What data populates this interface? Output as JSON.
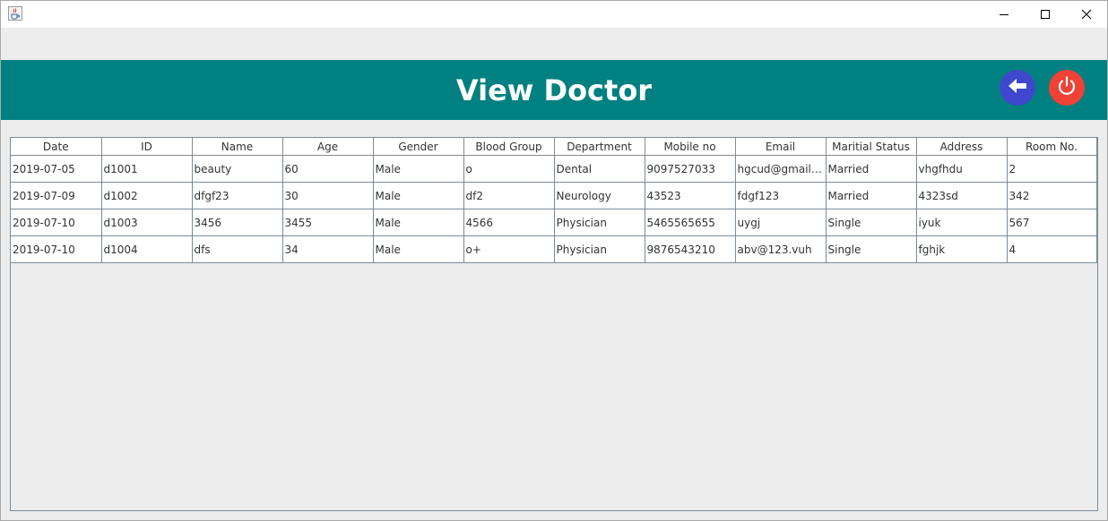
{
  "window": {
    "icon": "java-coffee-cup-icon",
    "controls": [
      "minimize-icon",
      "maximize-icon",
      "close-icon"
    ]
  },
  "header": {
    "title": "View Doctor",
    "background_color": "#008080",
    "back_button": {
      "icon": "arrow-left-icon",
      "color": "#3f48cc"
    },
    "power_button": {
      "icon": "power-icon",
      "color": "#ef4136"
    }
  },
  "table": {
    "columns": [
      "Date",
      "ID",
      "Name",
      "Age",
      "Gender",
      "Blood Group",
      "Department",
      "Mobile no",
      "Email",
      "Maritial Status",
      "Address",
      "Room No."
    ],
    "rows": [
      [
        "2019-07-05",
        "d1001",
        "beauty",
        "60",
        "Male",
        "o",
        "Dental",
        "9097527033",
        "hgcud@gmail.c...",
        "Married",
        "vhgfhdu",
        "2"
      ],
      [
        "2019-07-09",
        "d1002",
        "dfgf23",
        "30",
        "Male",
        "df2",
        "Neurology",
        "43523",
        "fdgf123",
        "Married",
        "4323sd",
        "342"
      ],
      [
        "2019-07-10",
        "d1003",
        "3456",
        "3455",
        "Male",
        "4566",
        "Physician",
        "5465565655",
        "uygj",
        "Single",
        "iyuk",
        "567"
      ],
      [
        "2019-07-10",
        "d1004",
        "dfs",
        "34",
        "Male",
        "o+",
        "Physician",
        "9876543210",
        "abv@123.vuh",
        "Single",
        "fghjk",
        "4"
      ]
    ]
  }
}
